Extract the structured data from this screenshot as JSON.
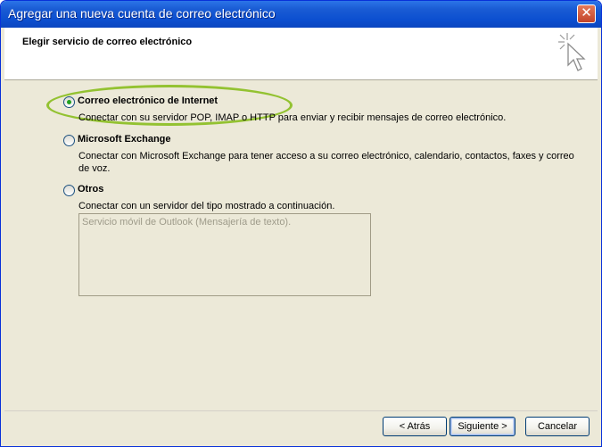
{
  "window": {
    "title": "Agregar una nueva cuenta de correo electrónico",
    "close_glyph": "✕"
  },
  "header": {
    "title": "Elegir servicio de correo electrónico",
    "icon": "wizard-cursor-sparkle-icon"
  },
  "options": [
    {
      "label": "Correo electrónico de Internet",
      "description": "Conectar con su servidor POP, IMAP o HTTP para enviar y recibir mensajes de correo electrónico.",
      "checked": true
    },
    {
      "label": "Microsoft Exchange",
      "description": "Conectar con Microsoft Exchange para tener acceso a su correo electrónico, calendario, contactos, faxes y correo de voz.",
      "checked": false
    },
    {
      "label": "Otros",
      "description": "Conectar con un servidor del tipo mostrado a continuación.",
      "checked": false
    }
  ],
  "other_services": [
    "Servicio móvil de Outlook (Mensajería de texto)."
  ],
  "buttons": {
    "back": "< Atrás",
    "next": "Siguiente >",
    "cancel": "Cancelar"
  },
  "colors": {
    "highlight": "#93c231",
    "titlebar": "#0c4fd0",
    "dialog_bg": "#ece9d8"
  }
}
